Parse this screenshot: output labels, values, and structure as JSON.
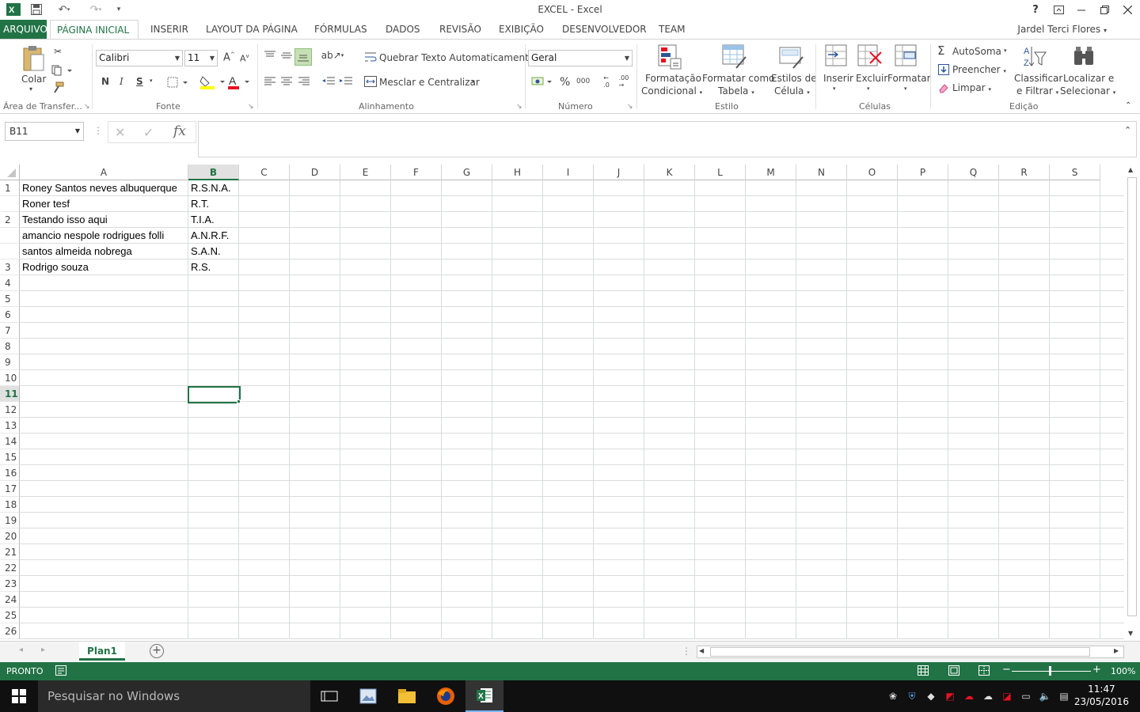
{
  "window": {
    "title": "EXCEL - Excel",
    "help": "?"
  },
  "ribbon_tabs": [
    "ARQUIVO",
    "PÁGINA INICIAL",
    "INSERIR",
    "LAYOUT DA PÁGINA",
    "FÓRMULAS",
    "DADOS",
    "REVISÃO",
    "EXIBIÇÃO",
    "DESENVOLVEDOR",
    "TEAM"
  ],
  "user": {
    "name": "Jardel Terci Flores"
  },
  "ribbon": {
    "clipboard": {
      "paste": "Colar",
      "label": "Área de Transfer..."
    },
    "font": {
      "name": "Calibri",
      "size": "11",
      "bold": "N",
      "italic": "I",
      "underline": "S",
      "label": "Fonte"
    },
    "alignment": {
      "wrap": "Quebrar Texto Automaticamente",
      "merge": "Mesclar e Centralizar",
      "label": "Alinhamento"
    },
    "number": {
      "format": "Geral",
      "percent": "%",
      "thousands": "000",
      "label": "Número"
    },
    "styles": {
      "cond_format_1": "Formatação",
      "cond_format_2": "Condicional",
      "format_table_1": "Formatar como",
      "format_table_2": "Tabela",
      "cell_styles_1": "Estilos de",
      "cell_styles_2": "Célula",
      "label": "Estilo"
    },
    "cells": {
      "insert": "Inserir",
      "delete": "Excluir",
      "format": "Formatar",
      "label": "Células"
    },
    "editing": {
      "autosum": "AutoSoma",
      "fill": "Preencher",
      "clear": "Limpar",
      "sort_1": "Classificar",
      "sort_2": "e Filtrar",
      "find_1": "Localizar e",
      "find_2": "Selecionar",
      "label": "Edição"
    }
  },
  "formula_bar": {
    "name_box": "B11",
    "fx": "fx",
    "value": ""
  },
  "columns": [
    "A",
    "B",
    "C",
    "D",
    "E",
    "F",
    "G",
    "H",
    "I",
    "J",
    "K",
    "L",
    "M",
    "N",
    "O",
    "P",
    "Q",
    "R",
    "S"
  ],
  "row_headers": [
    "1",
    "",
    "2",
    "",
    "",
    "3",
    "4",
    "5",
    "6",
    "7",
    "8",
    "9",
    "10",
    "11",
    "12",
    "13",
    "14",
    "15",
    "16",
    "17",
    "18",
    "19",
    "20",
    "21",
    "22",
    "23",
    "24",
    "25",
    "26"
  ],
  "cells": [
    {
      "a": "Roney Santos neves albuquerque",
      "b": "R.S.N.A."
    },
    {
      "a": "Roner tesf",
      "b": "R.T."
    },
    {
      "a": "Testando isso aqui",
      "b": "T.I.A."
    },
    {
      "a": "amancio nespole rodrigues folli",
      "b": "A.N.R.F."
    },
    {
      "a": "santos almeida nobrega",
      "b": "S.A.N."
    },
    {
      "a": "Rodrigo souza",
      "b": "R.S."
    }
  ],
  "sheet": {
    "tab": "Plan1"
  },
  "status": {
    "mode": "PRONTO",
    "zoom": "100%"
  },
  "taskbar": {
    "search": "Pesquisar no Windows",
    "time": "11:47",
    "date": "23/05/2016"
  }
}
